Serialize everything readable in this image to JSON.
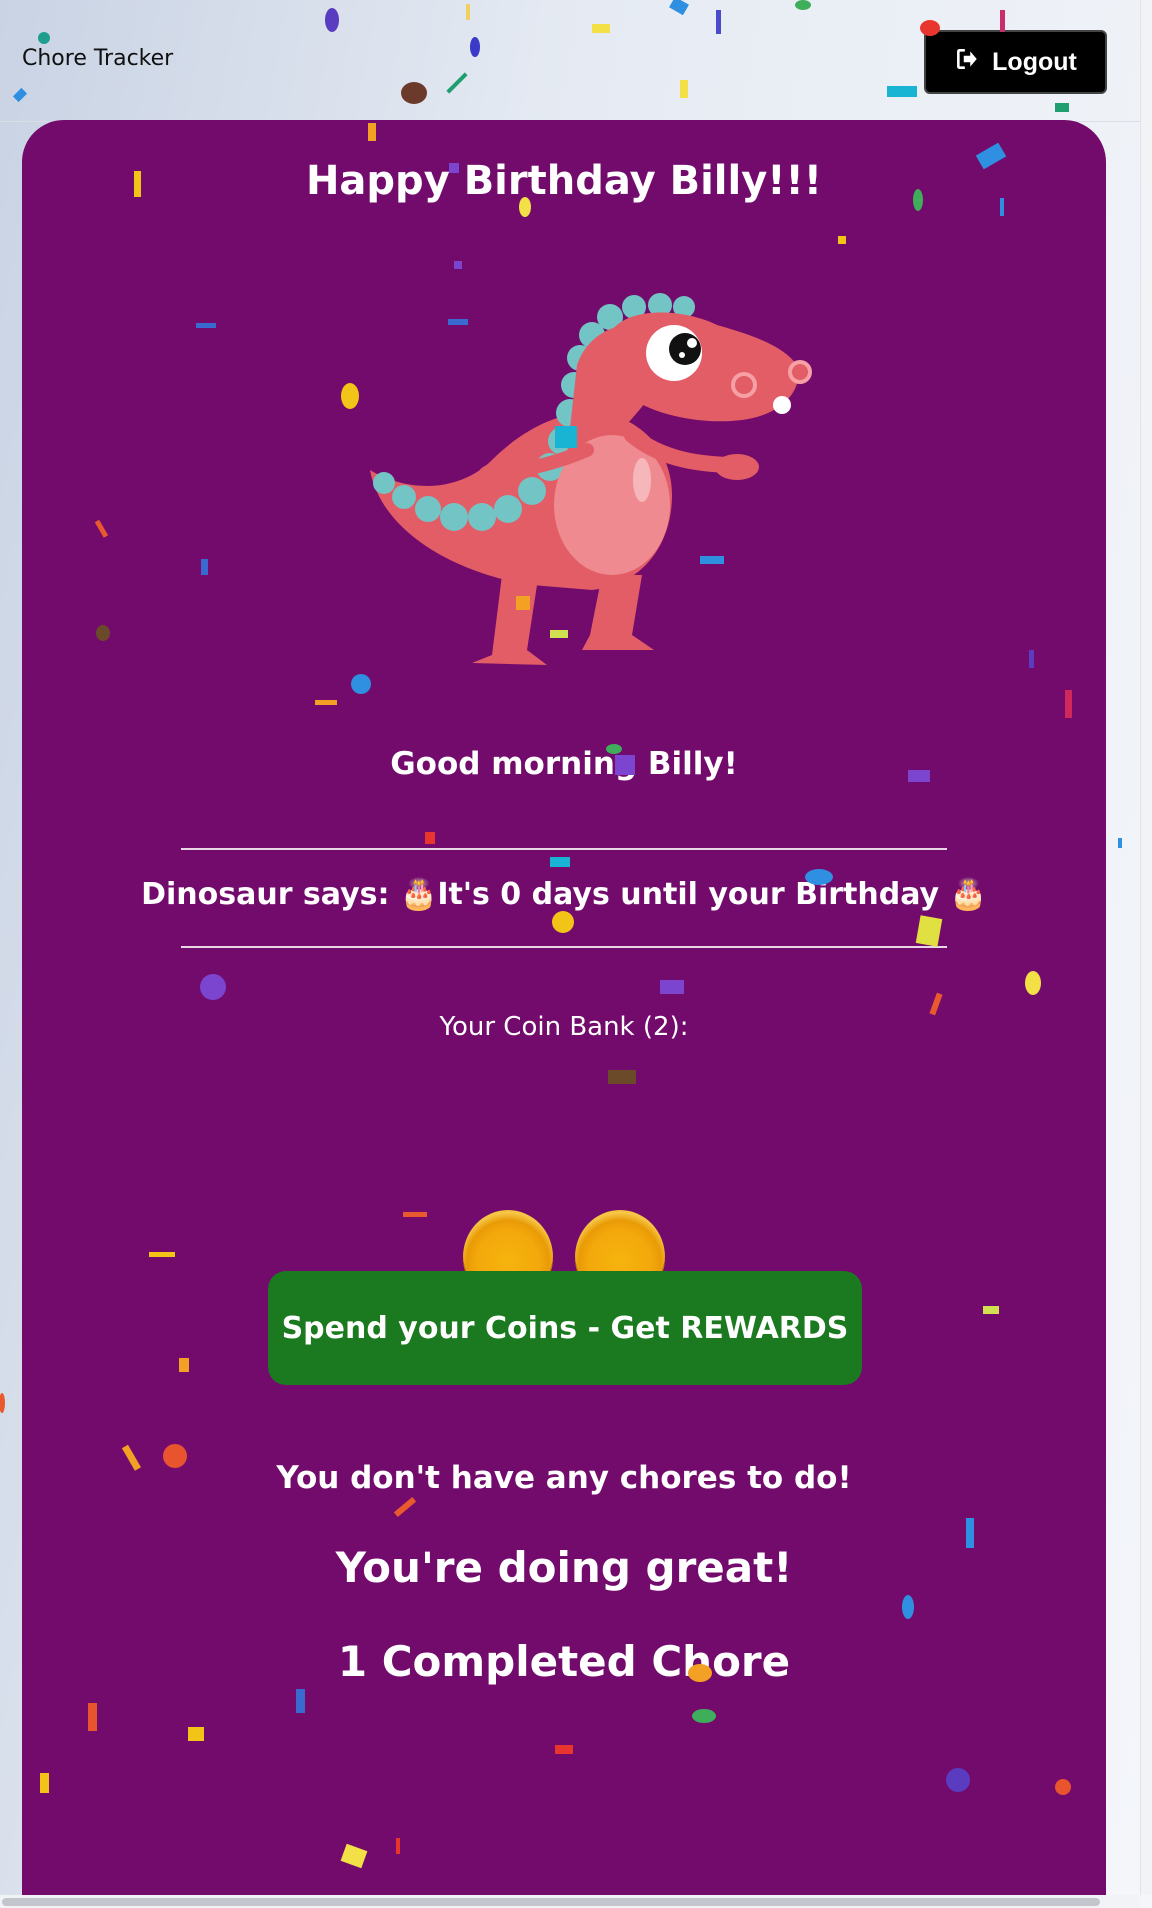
{
  "header": {
    "brand": "Chore Tracker",
    "logout_label": "Logout"
  },
  "main": {
    "title": "Happy Birthday Billy!!!",
    "greeting": "Good morning Billy!",
    "dinosaur_message": "Dinosaur says: 🎂It's 0 days until your Birthday 🎂",
    "coin_bank_label": "Your Coin Bank (2):",
    "coin_count": 2,
    "rewards_button": "Spend your Coins - Get REWARDS",
    "no_chores": "You don't have any chores to do!",
    "encouragement": "You're doing great!",
    "completed": "1 Completed Chore"
  },
  "colors": {
    "card": "#720b6c",
    "button": "#1b7a1f",
    "coin": "#f3a80c",
    "dino": "#e35d66",
    "dino_spikes": "#73c4c4"
  }
}
